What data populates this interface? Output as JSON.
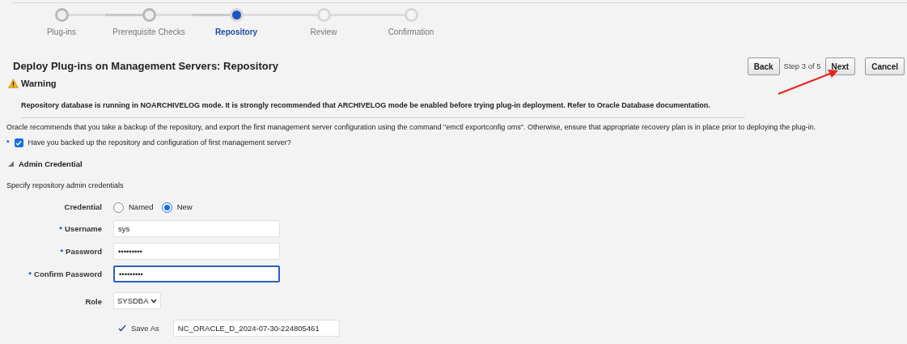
{
  "steps": [
    {
      "label": "Plug-ins",
      "selected": false,
      "completed": true
    },
    {
      "label": "Prerequisite Checks",
      "selected": false,
      "completed": true
    },
    {
      "label": "Repository",
      "selected": true,
      "completed": false
    },
    {
      "label": "Review",
      "selected": false,
      "completed": false
    },
    {
      "label": "Confirmation",
      "selected": false,
      "completed": false
    }
  ],
  "header": {
    "title": "Deploy Plug-ins on Management Servers: Repository",
    "back": "Back",
    "step_text": "Step 3 of 5",
    "next": "Next",
    "cancel": "Cancel"
  },
  "warning": {
    "title": "Warning",
    "message": "Repository database is running in NOARCHIVELOG mode. It is strongly recommended that ARCHIVELOG mode be enabled before trying plug-in deployment. Refer to Oracle Database documentation."
  },
  "info": "Oracle recommends that you take a backup of the repository, and export the first management server configuration using the command \"emctl exportconfig oms\". Otherwise, ensure that appropriate recovery plan is in place prior to deploying the plug-in.",
  "backup_check": {
    "required": "*",
    "label": "Have you backed up the repository and configuration of first management server?",
    "checked": true
  },
  "section": {
    "title": "Admin Credential",
    "expanded": true,
    "hint": "Specify repository admin credentials"
  },
  "credential": {
    "label": "Credential",
    "options": [
      {
        "label": "Named",
        "selected": false
      },
      {
        "label": "New",
        "selected": true
      }
    ]
  },
  "fields": [
    {
      "label": "Username",
      "required": true,
      "value": "sys",
      "focused": false
    },
    {
      "label": "Password",
      "required": true,
      "value": "•••••••••",
      "focused": false
    },
    {
      "label": "Confirm Password",
      "required": true,
      "value": "•••••••••",
      "focused": true
    }
  ],
  "role": {
    "label": "Role",
    "value": "SYSDBA"
  },
  "save_as": {
    "label": "Save As",
    "checked": true,
    "value": "NC_ORACLE_D_2024-07-30-224805461"
  }
}
